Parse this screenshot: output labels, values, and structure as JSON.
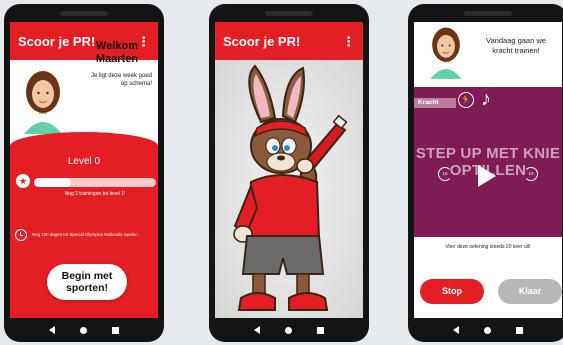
{
  "phone1": {
    "app_title": "Scoor je PR!",
    "welcome_title": "Welkom Maarten",
    "welcome_subtitle": "Je ligt deze week goed op schema!",
    "level_label": "Level 0",
    "progress_fraction": 0.3,
    "progress_text": "Nog 2 trainingen tot level 1!",
    "days_text": "Nog 100 dagen tot Special Olympics Nationale Spelen",
    "begin_button": "Begin met sporten!"
  },
  "phone2": {
    "app_title": "Scoor je PR!"
  },
  "phone3": {
    "coach_text": "Vandaag gaan we kracht trainen!",
    "category_tag": "Kracht",
    "exercise_title": "STEP UP MET KNIE OPTILLEN",
    "replay_back_label": "10",
    "replay_forward_label": "10",
    "instruction": "Voer deze oefening steeds 20 keer uit!",
    "stop_button": "Stop",
    "done_button": "Klaar"
  },
  "colors": {
    "brand_red": "#e31e24",
    "exercise_purple": "#7f1c54",
    "done_grey": "#b8b8b8"
  },
  "icons": [
    "menu-icon",
    "star-icon",
    "clock-icon",
    "runner-icon",
    "music-note-icon",
    "replay-back-icon",
    "play-icon",
    "replay-forward-icon",
    "nav-back-icon",
    "nav-home-icon",
    "nav-recent-icon"
  ]
}
